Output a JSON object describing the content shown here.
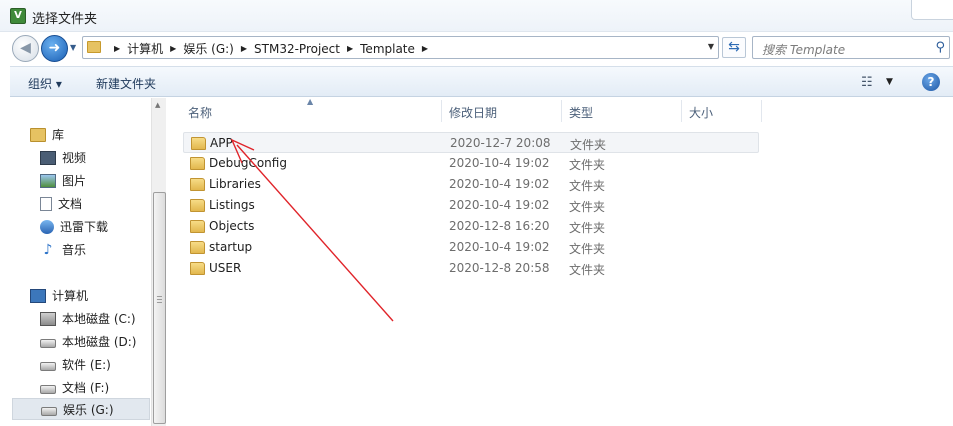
{
  "window": {
    "title": "选择文件夹",
    "app_icon_letter": "V"
  },
  "address": {
    "crumbs": [
      "计算机",
      "娱乐 (G:)",
      "STM32-Project",
      "Template"
    ]
  },
  "search": {
    "placeholder": "搜索 Template"
  },
  "toolbar": {
    "organize_label": "组织 ▾",
    "new_folder_label": "新建文件夹",
    "help_label": "?"
  },
  "navigation": {
    "favorites": [],
    "libraries": {
      "label": "库",
      "items": [
        "视频",
        "图片",
        "文档",
        "迅雷下载",
        "音乐"
      ]
    },
    "computer": {
      "label": "计算机",
      "drives": [
        "本地磁盘 (C:)",
        "本地磁盘 (D:)",
        "软件 (E:)",
        "文档 (F:)",
        "娱乐 (G:)"
      ],
      "selected": "娱乐 (G:)"
    }
  },
  "columns": {
    "name": "名称",
    "modified": "修改日期",
    "type": "类型",
    "size": "大小"
  },
  "files": [
    {
      "name": "APP",
      "modified": "2020-12-7 20:08",
      "type": "文件夹"
    },
    {
      "name": "DebugConfig",
      "modified": "2020-10-4 19:02",
      "type": "文件夹"
    },
    {
      "name": "Libraries",
      "modified": "2020-10-4 19:02",
      "type": "文件夹"
    },
    {
      "name": "Listings",
      "modified": "2020-10-4 19:02",
      "type": "文件夹"
    },
    {
      "name": "Objects",
      "modified": "2020-12-8 16:20",
      "type": "文件夹"
    },
    {
      "name": "startup",
      "modified": "2020-10-4 19:02",
      "type": "文件夹"
    },
    {
      "name": "USER",
      "modified": "2020-12-8 20:58",
      "type": "文件夹"
    }
  ],
  "colors": {
    "annotation_arrow": "#e0242a",
    "selection": "#e2e8ef",
    "accent": "#1a5fb4"
  }
}
